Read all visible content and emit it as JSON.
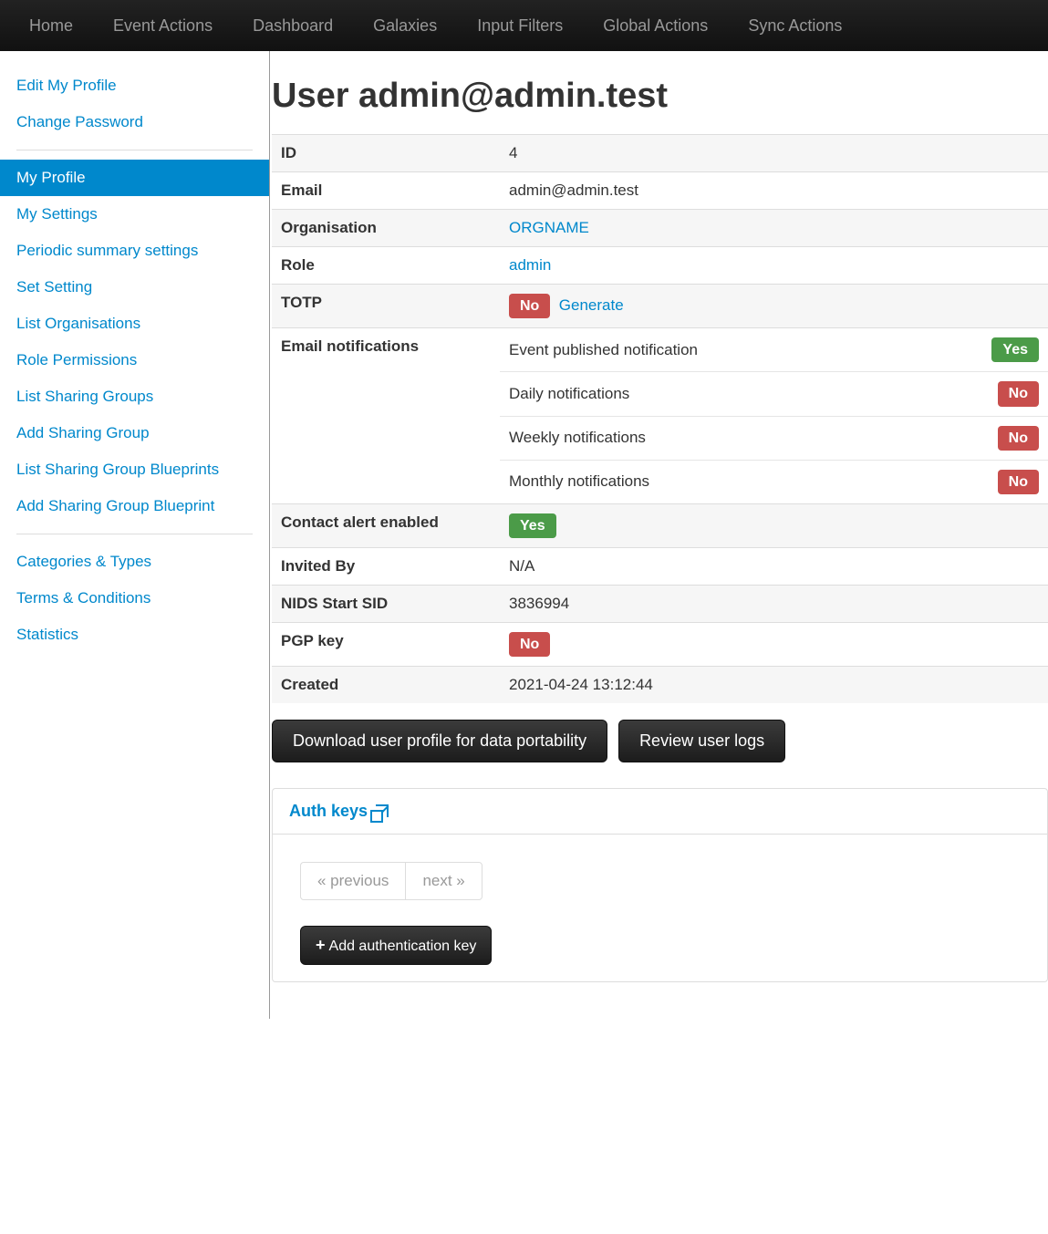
{
  "nav": {
    "home": "Home",
    "event_actions": "Event Actions",
    "dashboard": "Dashboard",
    "galaxies": "Galaxies",
    "input_filters": "Input Filters",
    "global_actions": "Global Actions",
    "sync_actions": "Sync Actions"
  },
  "sidebar": {
    "edit_profile": "Edit My Profile",
    "change_password": "Change Password",
    "my_profile": "My Profile",
    "my_settings": "My Settings",
    "periodic": "Periodic summary settings",
    "set_setting": "Set Setting",
    "list_organisations": "List Organisations",
    "role_permissions": "Role Permissions",
    "list_sharing_groups": "List Sharing Groups",
    "add_sharing_group": "Add Sharing Group",
    "list_sg_blueprints": "List Sharing Group Blueprints",
    "add_sg_blueprint": "Add Sharing Group Blueprint",
    "categories_types": "Categories & Types",
    "terms_conditions": "Terms & Conditions",
    "statistics": "Statistics"
  },
  "header": {
    "title": "User admin@admin.test"
  },
  "rows": {
    "id_key": "ID",
    "id_val": "4",
    "email_key": "Email",
    "email_val": "admin@admin.test",
    "org_key": "Organisation",
    "org_val": "ORGNAME",
    "role_key": "Role",
    "role_val": "admin",
    "totp_key": "TOTP",
    "totp_val": "No",
    "totp_generate": "Generate",
    "email_notif_key": "Email notifications",
    "notif_event_label": "Event published notification",
    "notif_event_val": "Yes",
    "notif_daily_label": "Daily notifications",
    "notif_daily_val": "No",
    "notif_weekly_label": "Weekly notifications",
    "notif_weekly_val": "No",
    "notif_monthly_label": "Monthly notifications",
    "notif_monthly_val": "No",
    "contact_alert_key": "Contact alert enabled",
    "contact_alert_val": "Yes",
    "invited_by_key": "Invited By",
    "invited_by_val": "N/A",
    "nids_key": "NIDS Start SID",
    "nids_val": "3836994",
    "pgp_key": "PGP key",
    "pgp_val": "No",
    "created_key": "Created",
    "created_val": "2021-04-24 13:12:44"
  },
  "buttons": {
    "download": "Download user profile for data portability",
    "review_logs": "Review user logs",
    "auth_keys": "Auth keys",
    "previous": "« previous",
    "next": "next »",
    "add_auth_key": "Add authentication key"
  }
}
